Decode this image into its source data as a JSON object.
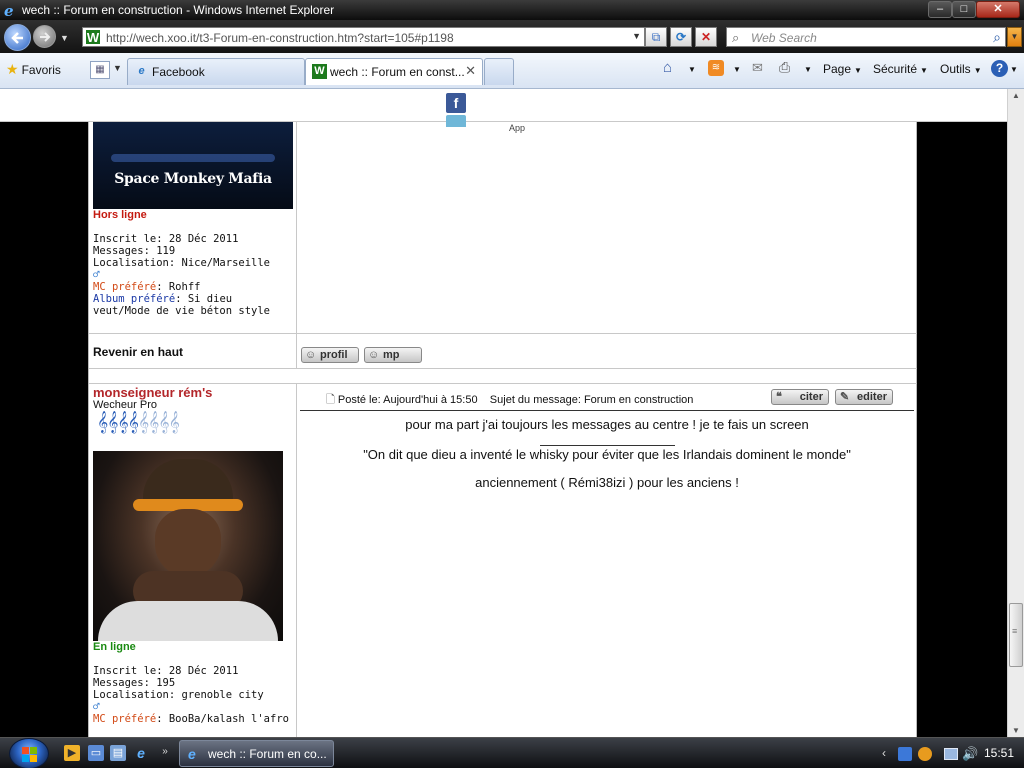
{
  "window": {
    "title": "wech :: Forum en construction - Windows Internet Explorer",
    "min": "–",
    "max": "□",
    "close": "✕"
  },
  "addressbar": {
    "url": "http://wech.xoo.it/t3-Forum-en-construction.htm?start=105#p1198",
    "search_placeholder": "Web Search"
  },
  "favorites_bar": {
    "favorites_label": "Favoris",
    "tabs": [
      {
        "label": "Facebook"
      },
      {
        "label": "wech :: Forum en const..."
      }
    ],
    "commands": {
      "page": "Page",
      "security": "Sécurité",
      "tools": "Outils"
    }
  },
  "forum": {
    "prev_post": {
      "banner_text": "Space Monkey Mafia",
      "status": "Hors ligne",
      "joined": "Inscrit le: 28 Déc 2011",
      "messages": "Messages: 119",
      "location": "Localisation: Nice/Marseille",
      "mc_label": "MC préféré",
      "mc_value": ": Rohff",
      "album_label": "Album préféré",
      "album_value": ": Si dieu veut/Mode de vie béton style",
      "back_to_top": "Revenir en haut",
      "profil_button": "profil",
      "mp_button": "mp",
      "partial_text": "App"
    },
    "post": {
      "username": "monseigneur rém's",
      "rank": "Wecheur Pro",
      "rank_notes_filled": 4,
      "rank_notes_total": 8,
      "status": "En ligne",
      "joined": "Inscrit le: 28 Déc 2011",
      "messages": "Messages: 195",
      "location": "Localisation: grenoble city",
      "mc_label": "MC préféré",
      "mc_value": ": BooBa/kalash l'afro",
      "posted": "Posté le: Aujourd'hui à 15:50",
      "subject": "Sujet du message: Forum en construction",
      "quote_button": "citer",
      "edit_button": "editer",
      "body_line1": "pour ma part j'ai toujours les messages au centre ! je te fais un screen",
      "body_line2": "\"On dit que dieu a inventé le whisky pour éviter que les Irlandais dominent le monde\"",
      "body_line3": "anciennement ( Rémi38izi ) pour les anciens !"
    }
  },
  "taskbar": {
    "task_label": "wech :: Forum en co...",
    "clock": "15:51"
  }
}
